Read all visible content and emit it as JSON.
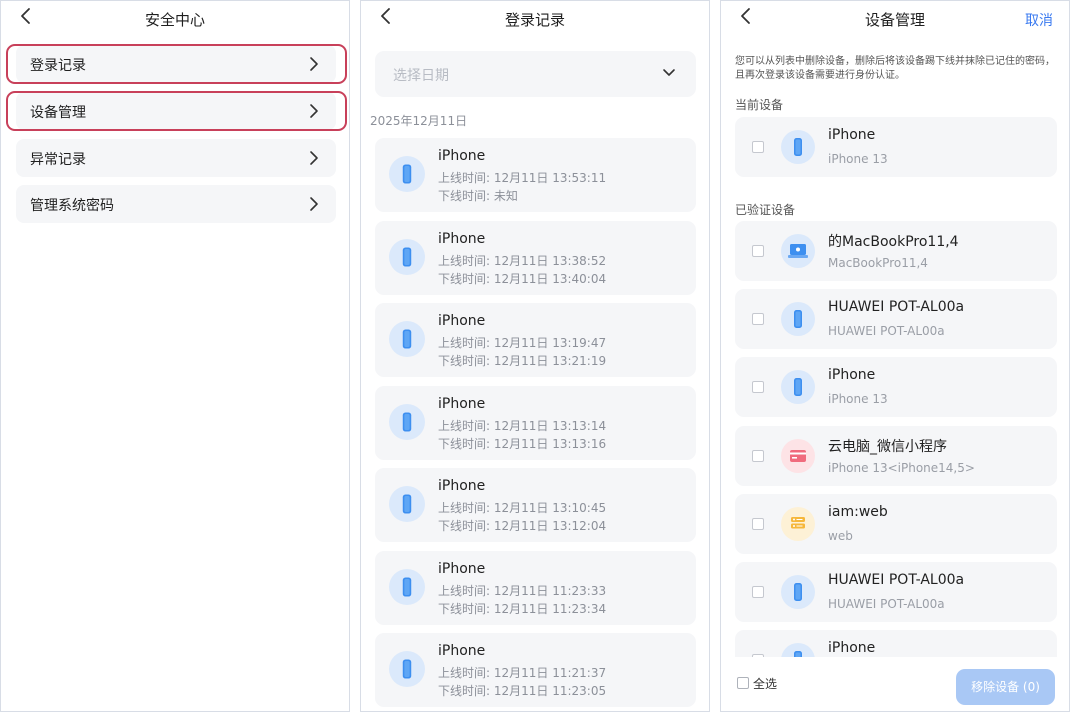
{
  "security_center": {
    "title": "安全中心",
    "items": [
      {
        "label": "登录记录",
        "highlighted": true
      },
      {
        "label": "设备管理",
        "highlighted": true
      },
      {
        "label": "异常记录",
        "highlighted": false
      },
      {
        "label": "管理系统密码",
        "highlighted": false
      }
    ]
  },
  "login_records": {
    "title": "登录记录",
    "date_placeholder": "选择日期",
    "date_header": "2025年12月11日",
    "records": [
      {
        "device": "iPhone",
        "online": "上线时间: 12月11日 13:53:11",
        "offline": "下线时间: 未知"
      },
      {
        "device": "iPhone",
        "online": "上线时间: 12月11日 13:38:52",
        "offline": "下线时间: 12月11日 13:40:04"
      },
      {
        "device": "iPhone",
        "online": "上线时间: 12月11日 13:19:47",
        "offline": "下线时间: 12月11日 13:21:19"
      },
      {
        "device": "iPhone",
        "online": "上线时间: 12月11日 13:13:14",
        "offline": "下线时间: 12月11日 13:13:16"
      },
      {
        "device": "iPhone",
        "online": "上线时间: 12月11日 13:10:45",
        "offline": "下线时间: 12月11日 13:12:04"
      },
      {
        "device": "iPhone",
        "online": "上线时间: 12月11日 11:23:33",
        "offline": "下线时间: 12月11日 11:23:34"
      },
      {
        "device": "iPhone",
        "online": "上线时间: 12月11日 11:21:37",
        "offline": "下线时间: 12月11日 11:23:05"
      }
    ]
  },
  "device_mgmt": {
    "title": "设备管理",
    "cancel_label": "取消",
    "info": "您可以从列表中删除设备，删除后将该设备踢下线并抹除已记住的密码，且再次登录该设备需要进行身份认证。",
    "current_label": "当前设备",
    "verified_label": "已验证设备",
    "current_device": {
      "name": "iPhone",
      "model": "iPhone 13",
      "icon": "phone-icon"
    },
    "verified_devices": [
      {
        "name": "的MacBookPro11,4",
        "model": "MacBookPro11,4",
        "icon": "laptop-icon"
      },
      {
        "name": "HUAWEI POT-AL00a",
        "model": "HUAWEI POT-AL00a",
        "icon": "phone-icon"
      },
      {
        "name": "iPhone",
        "model": "iPhone 13",
        "icon": "phone-icon"
      },
      {
        "name": "云电脑_微信小程序",
        "model": "iPhone 13<iPhone14,5>",
        "icon": "mini-program-icon"
      },
      {
        "name": "iam:web",
        "model": "web",
        "icon": "web-icon"
      },
      {
        "name": "HUAWEI POT-AL00a",
        "model": "HUAWEI POT-AL00a",
        "icon": "phone-icon"
      },
      {
        "name": "iPhone",
        "model": "",
        "icon": "phone-icon"
      }
    ],
    "select_all_label": "全选",
    "remove_label": "移除设备 (0)"
  },
  "colors": {
    "accent": "#3a7af0",
    "highlight_border": "#c8405a",
    "card_bg": "#f5f6f8",
    "button_disabled": "#a9c8f5"
  }
}
